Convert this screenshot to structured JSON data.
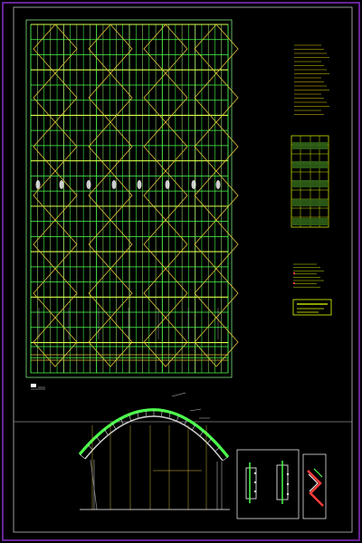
{
  "colors": {
    "background": "#000000",
    "outer_frame": "#8b2fc9",
    "inner_frame": "#ffffff",
    "primary_lines": "#4cff4c",
    "secondary_lines": "#e0c23a",
    "annotation_text": "#ffea00",
    "highlight_table": "#e6ff00",
    "dim_lines": "#cccccc",
    "gray_fill": "#8a8a8a",
    "red_mark": "#ff3b3b"
  },
  "drawing": {
    "layout_title": "",
    "section_title": "",
    "detail_title": "",
    "notes_title": "",
    "notes_lines": [],
    "material_table_title": "",
    "material_table_rows": [],
    "bottom_legend_lines": [],
    "connection_details": {
      "left_detail_label": "",
      "right_detail_label": ""
    }
  }
}
